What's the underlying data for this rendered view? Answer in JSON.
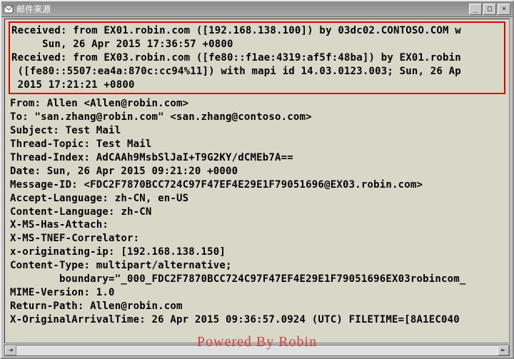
{
  "window": {
    "title": "邮件来源"
  },
  "controls": {
    "minimize": "_",
    "maximize": "□",
    "close": "×"
  },
  "highlight": {
    "line1": "Received: from EX01.robin.com ([192.168.138.100]) by 03dc02.CONTOSO.COM w",
    "line2": "     Sun, 26 Apr 2015 17:36:57 +0800",
    "line3": "Received: from EX03.robin.com ([fe80::f1ae:4319:af5f:48ba]) by EX01.robin",
    "line4": " ([fe80::5507:ea4a:870c:cc94%11]) with mapi id 14.03.0123.003; Sun, 26 Ap",
    "line5": " 2015 17:21:21 +0800"
  },
  "body": {
    "from": "From: Allen <Allen@robin.com>",
    "to": "To: \"san.zhang@robin.com\" <san.zhang@contoso.com>",
    "subject": "Subject: Test Mail",
    "threadTopic": "Thread-Topic: Test Mail",
    "threadIndex": "Thread-Index: AdCAAh9MsbSlJaI+T9G2KY/dCMEb7A==",
    "date": "Date: Sun, 26 Apr 2015 09:21:20 +0000",
    "messageId": "Message-ID: <FDC2F7870BCC724C97F47EF4E29E1F79051696@EX03.robin.com>",
    "acceptLang": "Accept-Language: zh-CN, en-US",
    "contentLang": "Content-Language: zh-CN",
    "hasAttach": "X-MS-Has-Attach:",
    "tnef": "X-MS-TNEF-Correlator:",
    "origIp": "x-originating-ip: [192.168.138.150]",
    "contentType": "Content-Type: multipart/alternative;",
    "boundary": "        boundary=\"_000_FDC2F7870BCC724C97F47EF4E29E1F79051696EX03robincom_",
    "mime": "MIME-Version: 1.0",
    "returnPath": "Return-Path: Allen@robin.com",
    "arrival": "X-OriginalArrivalTime: 26 Apr 2015 09:36:57.0924 (UTC) FILETIME=[8A1EC040"
  },
  "scrollbar": {
    "left": "◄",
    "right": "►"
  },
  "watermark": "Powered By Robin"
}
